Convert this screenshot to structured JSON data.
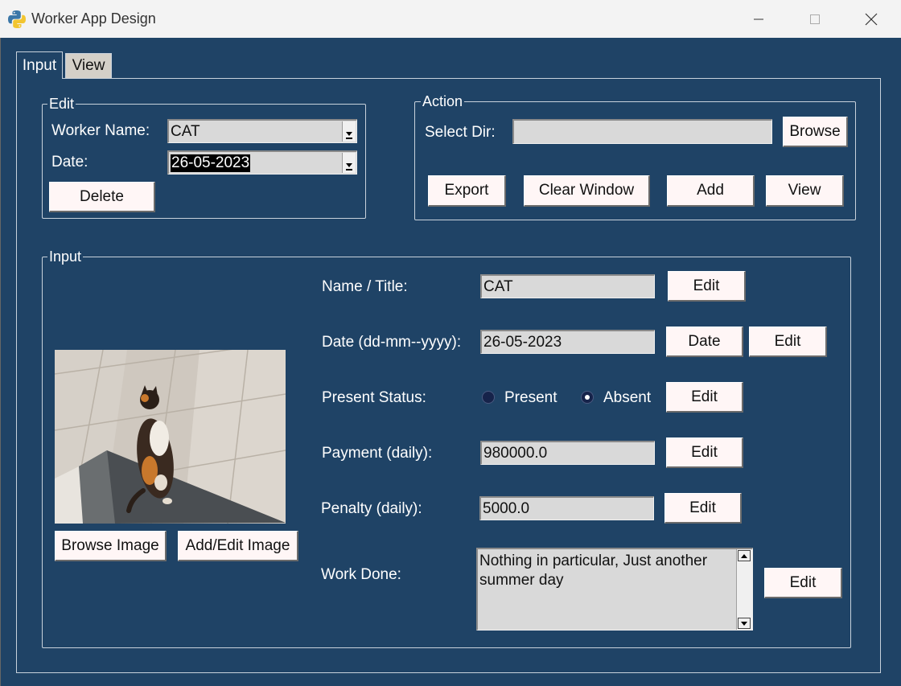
{
  "window": {
    "title": "Worker App Design",
    "minimize": "—",
    "maximize": "☐",
    "close": "✕"
  },
  "tabs": [
    {
      "label": "Input",
      "selected": true
    },
    {
      "label": "View",
      "selected": false
    }
  ],
  "edit_frame": {
    "title": "Edit",
    "worker_name_label": "Worker Name:",
    "worker_name_value": "CAT",
    "date_label": "Date:",
    "date_value": "26-05-2023",
    "delete_label": "Delete"
  },
  "action_frame": {
    "title": "Action",
    "select_dir_label": "Select Dir:",
    "select_dir_value": "",
    "browse_label": "Browse",
    "export_label": "Export",
    "clear_window_label": "Clear Window",
    "add_label": "Add",
    "view_label": "View"
  },
  "input_frame": {
    "title": "Input",
    "browse_image_label": "Browse Image",
    "add_edit_image_label": "Add/Edit Image",
    "name_label": "Name / Title:",
    "name_value": "CAT",
    "date_label": "Date (dd-mm--yyyy):",
    "date_value": "26-05-2023",
    "date_button_label": "Date",
    "present_status_label": "Present Status:",
    "present_option": "Present",
    "absent_option": "Absent",
    "selected_status": "Absent",
    "payment_label": "Payment (daily):",
    "payment_value": "980000.0",
    "penalty_label": "Penalty (daily):",
    "penalty_value": "5000.0",
    "work_done_label": "Work Done:",
    "work_done_value": "Nothing in particular, Just another\nsummer day",
    "edit_label": "Edit"
  },
  "colors": {
    "background": "#1f4366",
    "button": "#fff6f6",
    "field": "#d9d9d9",
    "titlebar": "#f3f3f3"
  }
}
